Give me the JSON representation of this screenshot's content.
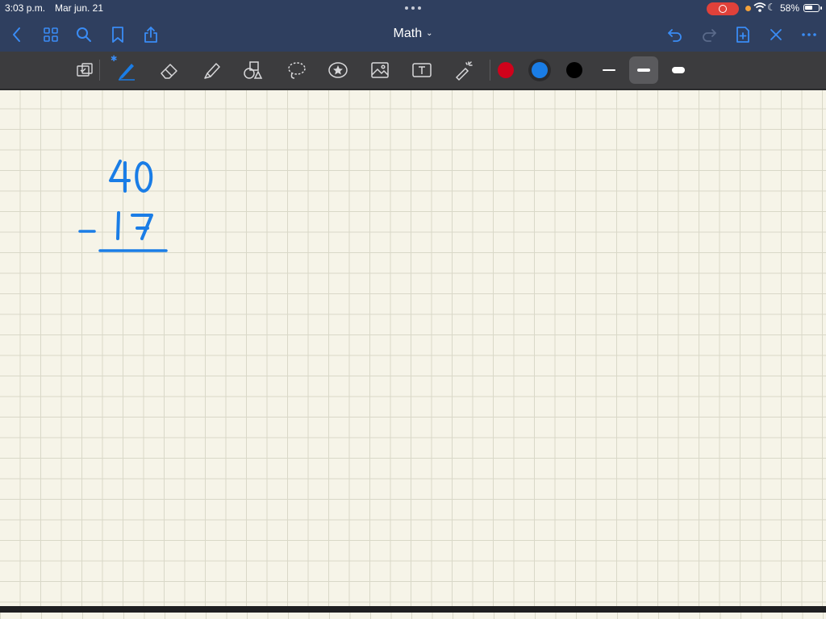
{
  "status_bar": {
    "time": "3:03 p.m.",
    "date": "Mar jun. 21",
    "battery": "58%",
    "icons": [
      "screen-record-icon",
      "wifi-icon",
      "moon-icon",
      "battery-icon"
    ]
  },
  "nav": {
    "title": "Math",
    "icons": [
      "back-chevron-icon",
      "grid-icon",
      "search-icon",
      "bookmark-icon",
      "share-icon",
      "undo-icon",
      "redo-icon",
      "add-page-icon",
      "close-icon",
      "more-icon"
    ]
  },
  "toolbar": {
    "tools": [
      "read-only-mode-icon",
      "pen-icon",
      "eraser-icon",
      "highlighter-icon",
      "shapes-icon",
      "lasso-icon",
      "elements-sticker-icon",
      "image-icon",
      "text-icon",
      "laser-pointer-icon"
    ],
    "active_tool": "pen",
    "colors": [
      "#d0021b",
      "#1a7de6",
      "#000000"
    ],
    "selected_color": "#1a7de6",
    "stroke_widths": [
      "thin",
      "medium",
      "thick"
    ],
    "selected_stroke": "medium"
  },
  "canvas": {
    "paper": "grid",
    "ink_color": "#1a7de6",
    "handwriting": {
      "top_number": "40",
      "operator": "-",
      "bottom_number": "17"
    }
  }
}
